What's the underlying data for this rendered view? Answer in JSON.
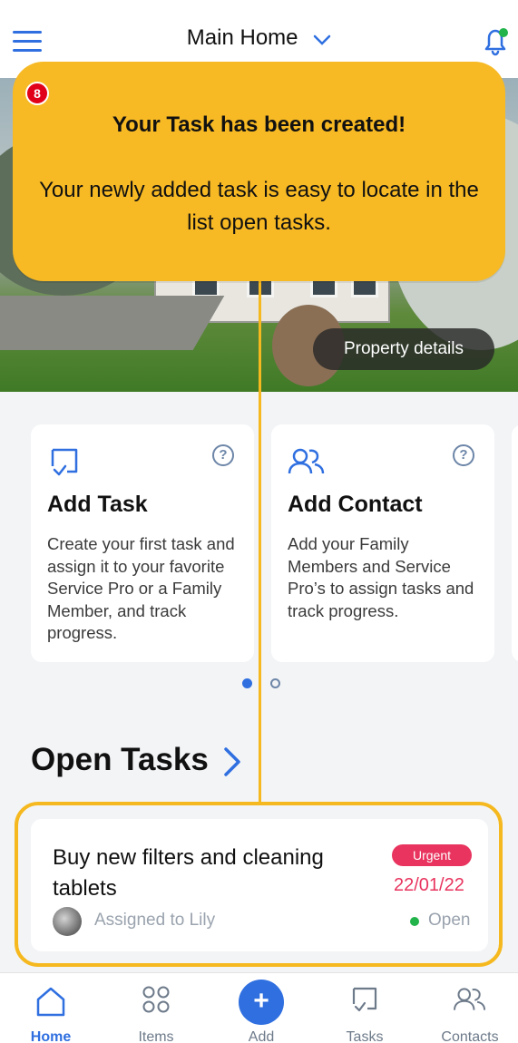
{
  "header": {
    "title": "Main Home",
    "menu_icon": "hamburger-menu-icon",
    "dropdown_icon": "chevron-down-icon",
    "notification_icon": "bell-icon",
    "notification_indicator_color": "#22b34a"
  },
  "hero": {
    "property_button_label": "Property details"
  },
  "callout": {
    "step_number": "8",
    "title": "Your Task has been created!",
    "body": "Your newly added task is easy to locate in the list open tasks."
  },
  "cards": [
    {
      "icon": "task-icon",
      "title": "Add Task",
      "description": "Create your first task and assign it to your favorite Service Pro or a Family Member, and track progress."
    },
    {
      "icon": "contacts-icon",
      "title": "Add Contact",
      "description": "Add your Family Members and Service Pro’s to assign tasks and track progress."
    }
  ],
  "carousel": {
    "pages": 2,
    "active": 1
  },
  "open_tasks": {
    "heading": "Open Tasks",
    "tasks": [
      {
        "title": "Buy new filters and cleaning tablets",
        "priority": "Urgent",
        "due_date": "22/01/22",
        "assignee_text": "Assigned to Lily",
        "status": "Open"
      }
    ]
  },
  "nav": {
    "items": [
      {
        "label": "Home",
        "icon": "home-icon"
      },
      {
        "label": "Items",
        "icon": "items-grid-icon"
      },
      {
        "label": "Add",
        "icon": "plus-icon"
      },
      {
        "label": "Tasks",
        "icon": "tasks-icon"
      },
      {
        "label": "Contacts",
        "icon": "contacts-icon"
      }
    ],
    "add_symbol": "+"
  },
  "colors": {
    "accent": "#2f6fe0",
    "callout": "#f7b924",
    "highlight": "#f5b81e",
    "urgent": "#e8345e",
    "open_status": "#22b34a"
  }
}
